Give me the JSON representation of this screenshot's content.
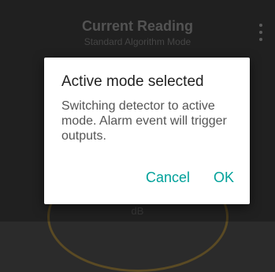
{
  "app_bar": {
    "title": "Current Reading",
    "subtitle": "Standard Algorithm Mode",
    "menu_icon": "overflow-menu-icon"
  },
  "gauge": {
    "unit": "dB"
  },
  "dialog": {
    "title": "Active mode selected",
    "message": "Switching detector to active mode. Alarm event will trigger outputs.",
    "cancel_label": "Cancel",
    "ok_label": "OK"
  },
  "colors": {
    "accent": "#00a19a",
    "background": "#2b2b2b",
    "dialog_background": "#ffffff"
  }
}
